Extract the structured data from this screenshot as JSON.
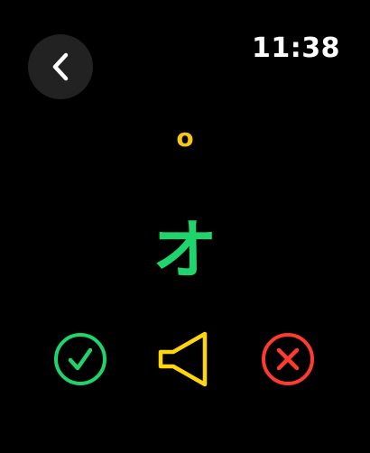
{
  "status_bar": {
    "time": "11:38",
    "back_icon": "chevron-left-icon"
  },
  "card": {
    "romaji": "o",
    "kana": "オ"
  },
  "actions": {
    "correct_icon": "checkmark-circle-icon",
    "speaker_icon": "speaker-icon",
    "wrong_icon": "x-circle-icon"
  },
  "colors": {
    "background": "#000000",
    "back_button_bg": "#222222",
    "romaji": "#f5c518",
    "kana": "#1fd46d",
    "correct": "#1fd46d",
    "speaker": "#ffd60a",
    "wrong": "#ff3b30"
  }
}
